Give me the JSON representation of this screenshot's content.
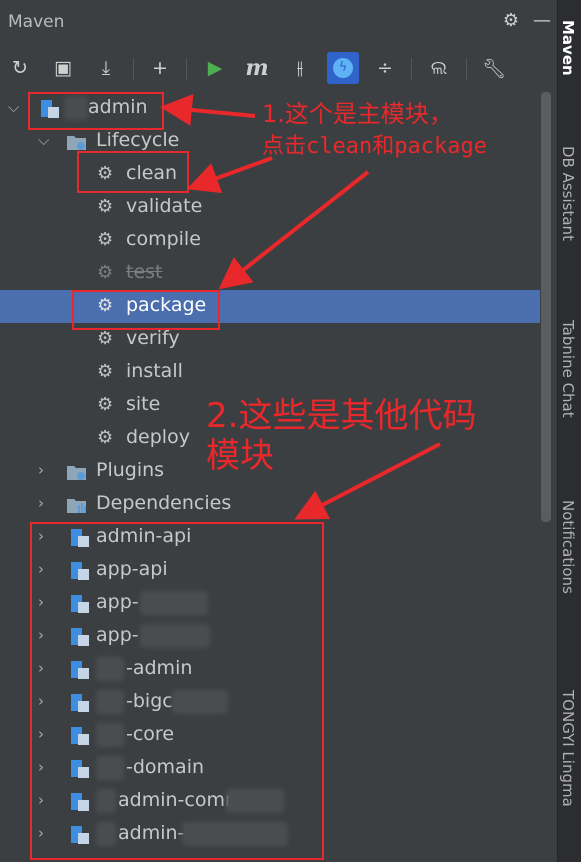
{
  "window": {
    "title": "Maven"
  },
  "header_icons": [
    "gear-icon",
    "minimize-icon"
  ],
  "toolbar": {
    "tools": [
      "reload-icon",
      "generate-sources-icon",
      "download-icon",
      "add-icon",
      "run-icon",
      "maven-goal-icon",
      "toggle-offline-icon",
      "skip-tests-icon",
      "collapse-icon",
      "analyze-icon",
      "settings-icon"
    ],
    "m_label": "m"
  },
  "tree": {
    "root": {
      "label": "admin"
    },
    "lifecycle": {
      "label": "Lifecycle",
      "goals": [
        "clean",
        "validate",
        "compile",
        "test",
        "package",
        "verify",
        "install",
        "site",
        "deploy"
      ]
    },
    "plugins": {
      "label": "Plugins"
    },
    "dependencies": {
      "label": "Dependencies"
    },
    "modules": [
      "admin-api",
      "app-api",
      "app-",
      "app-",
      "-admin",
      "-bigc",
      "-core",
      "-domain",
      "admin-comm",
      "admin-"
    ]
  },
  "sidebar": {
    "tabs": [
      "Maven",
      "DB Assistant",
      "Tabnine Chat",
      "Notifications",
      "TONGYI Lingma"
    ]
  },
  "annotations": {
    "note1_line1": "1.这个是主模块，",
    "note1_line2": "点击clean和package",
    "note2_line1": "2.这些是其他代码",
    "note2_line2": "模块"
  },
  "colors": {
    "panel": "#3c3f41",
    "selection": "#4b6eaf",
    "annotation": "#e8282b",
    "run": "#4caf50"
  }
}
